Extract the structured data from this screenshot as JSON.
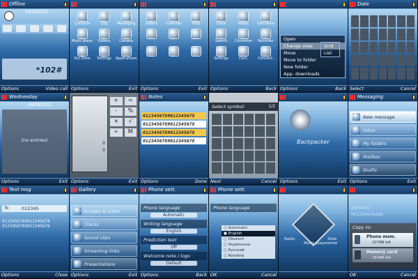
{
  "screens": [
    {
      "id": "home",
      "title": "Offline",
      "date": "04/06/2011",
      "softkeys": [
        "Options",
        "Video call"
      ],
      "shortcuts": [
        "",
        "",
        "",
        "",
        "",
        "",
        ""
      ],
      "dial_text": "*102#"
    },
    {
      "id": "menu1",
      "title": "",
      "softkeys": [
        "Options",
        "Exit"
      ],
      "icons": [
        "Contacts",
        "Log",
        "Messaging",
        "Music player",
        "Gallery",
        "Camera",
        "Ovi Store",
        "Settings",
        "Applications"
      ]
    },
    {
      "id": "menu2",
      "title": "",
      "softkeys": [
        "Options",
        "Exit"
      ],
      "icons": [
        "Gallery",
        "Calendar",
        "Help",
        "",
        "",
        "",
        "",
        "",
        ""
      ]
    },
    {
      "id": "menu3",
      "title": "",
      "softkeys": [
        "Options",
        "Back"
      ],
      "icons": [
        "Clock",
        "Notes",
        "Calculator",
        "Search",
        "Converter",
        "Recorder",
        "Settings",
        "Cont.",
        "Connect."
      ]
    },
    {
      "id": "options",
      "title": "",
      "softkeys": [
        "Options",
        "Back"
      ],
      "menu_items": [
        "Open",
        "Change view",
        "Move",
        "Move to folder",
        "New folder",
        "App. downloads"
      ],
      "submenu_items": [
        "Grid",
        "List"
      ]
    },
    {
      "id": "calendar",
      "title": "Date",
      "softkeys": [
        "Select",
        "Cancel"
      ]
    },
    {
      "id": "calendar-day",
      "title": "Wednesday",
      "date": "08/06/2011",
      "empty_text": "(no entries)",
      "softkeys": [
        "Options",
        "Exit"
      ]
    },
    {
      "id": "calculator",
      "title": "",
      "softkeys": [
        "Options",
        "Exit"
      ],
      "display_values": [
        "0",
        "0"
      ],
      "operators": [
        "+",
        "-",
        "×",
        "÷",
        "=",
        "%",
        "√",
        "M"
      ]
    },
    {
      "id": "notes",
      "title": "Notes",
      "softkeys": [
        "Options",
        "Done"
      ],
      "lines": [
        "0123456789012345678",
        "0123456789012345678",
        "0123456789012345678",
        "0123456789012345678"
      ]
    },
    {
      "id": "symbols",
      "title": "",
      "header": "Select symbol:",
      "page": "1/2",
      "softkeys": [
        "Next",
        "Cancel"
      ]
    },
    {
      "id": "player",
      "title": "",
      "track_title": "Backpacker",
      "softkeys": [
        "Options",
        "Exit"
      ]
    },
    {
      "id": "messaging",
      "title": "Messaging",
      "softkeys": [
        "Options",
        "Exit"
      ],
      "items": [
        "New message",
        "Inbox",
        "My folders",
        "Mailbox",
        "Drafts"
      ]
    },
    {
      "id": "text-editor",
      "title": "Text msg",
      "to": "To",
      "field": "012345",
      "body": [
        "0123456789012345678",
        "0123456789012345678"
      ],
      "softkeys": [
        "Options",
        "Close"
      ]
    },
    {
      "id": "gallery",
      "title": "Gallery",
      "softkeys": [
        "Options",
        "Exit"
      ],
      "items": [
        "Images & video",
        "Tracks",
        "Sound clips",
        "Streaming links",
        "Presentations"
      ]
    },
    {
      "id": "phone-settings",
      "title": "Phone sett.",
      "softkeys": [
        "Options",
        "Back"
      ],
      "settings": [
        {
          "label": "Phone language",
          "value": "Automatic"
        },
        {
          "label": "Writing language",
          "value": "English"
        },
        {
          "label": "Prediction text",
          "value": "Off"
        },
        {
          "label": "Welcome note / logo",
          "value": "Default"
        }
      ]
    },
    {
      "id": "language",
      "title": "Phone sett.",
      "header": "Phone language",
      "softkeys": [
        "OK",
        "Cancel"
      ],
      "options": [
        "Automatic",
        "English",
        "Deutsch",
        "Українська",
        "Русский",
        "Română"
      ],
      "selected": "English"
    },
    {
      "id": "multimedia",
      "title": "",
      "labels": [
        "Radio",
        "Music player",
        "Slide show"
      ],
      "softkeys": [
        "",
        ""
      ]
    },
    {
      "id": "copy",
      "title": "",
      "header": "Copy to:",
      "softkeys": [
        "OK",
        "Cancel"
      ],
      "folder_items": [
        "ESPKit01",
        "HCCDownloads"
      ],
      "targets": [
        {
          "label": "Phone mem.",
          "sub": "107MB left"
        },
        {
          "label": "Memory card",
          "sub": "764MB left"
        }
      ]
    }
  ]
}
